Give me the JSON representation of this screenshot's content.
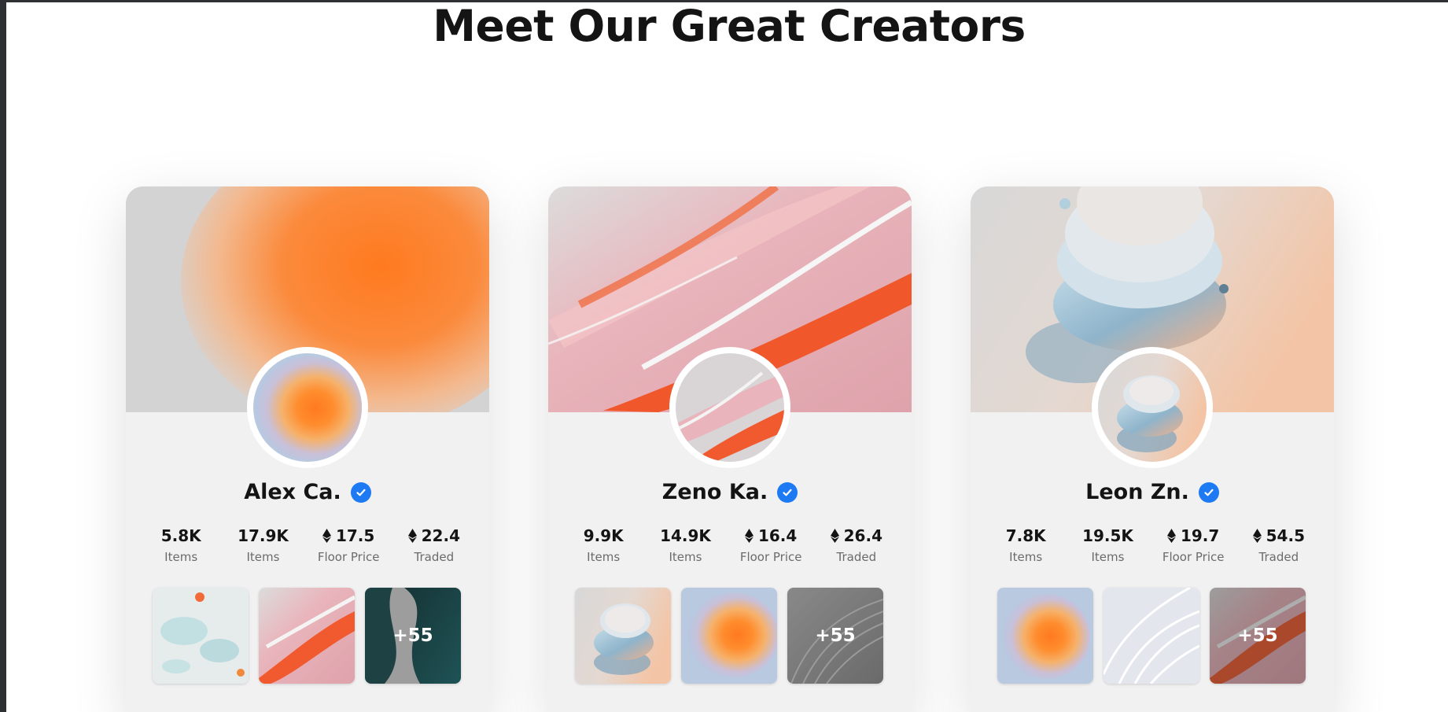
{
  "section": {
    "title": "Meet Our Great Creators"
  },
  "colors": {
    "verified": "#1d7af3",
    "text": "#141414",
    "muted": "#6b6b6b",
    "card": "#f1f1f1"
  },
  "creators": [
    {
      "name": "Alex Ca.",
      "verified": true,
      "stats": [
        {
          "value": "5.8K",
          "label": "Items",
          "eth": false
        },
        {
          "value": "17.9K",
          "label": "Items",
          "eth": false
        },
        {
          "value": "17.5",
          "label": "Floor Price",
          "eth": true
        },
        {
          "value": "22.4",
          "label": "Traded",
          "eth": true
        }
      ],
      "more": "+55"
    },
    {
      "name": "Zeno Ka.",
      "verified": true,
      "stats": [
        {
          "value": "9.9K",
          "label": "Items",
          "eth": false
        },
        {
          "value": "14.9K",
          "label": "Items",
          "eth": false
        },
        {
          "value": "16.4",
          "label": "Floor Price",
          "eth": true
        },
        {
          "value": "26.4",
          "label": "Traded",
          "eth": true
        }
      ],
      "more": "+55"
    },
    {
      "name": "Leon Zn.",
      "verified": true,
      "stats": [
        {
          "value": "7.8K",
          "label": "Items",
          "eth": false
        },
        {
          "value": "19.5K",
          "label": "Items",
          "eth": false
        },
        {
          "value": "19.7",
          "label": "Floor Price",
          "eth": true
        },
        {
          "value": "54.5",
          "label": "Traded",
          "eth": true
        }
      ],
      "more": "+55"
    }
  ]
}
